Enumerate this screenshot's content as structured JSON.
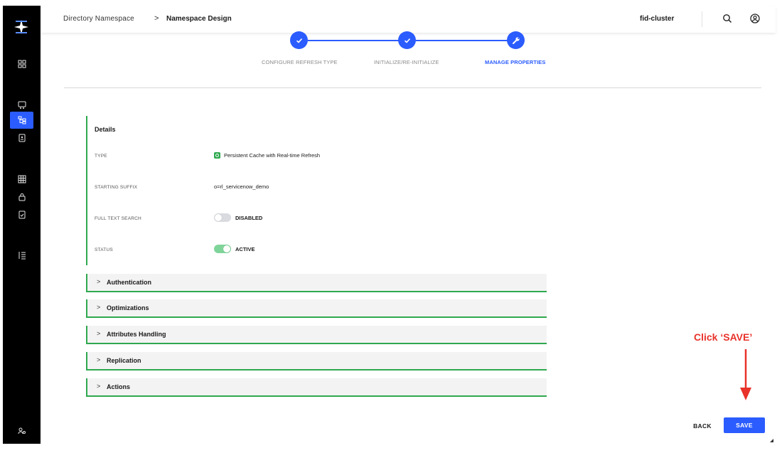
{
  "breadcrumb": {
    "parent": "Directory Namespace",
    "separator": ">",
    "current": "Namespace Design"
  },
  "header": {
    "cluster": "fid-cluster",
    "icons": [
      "search-icon",
      "user-icon"
    ]
  },
  "sidebar": {
    "icons": [
      "logo-icon",
      "dashboard-icon",
      "monitoring-icon",
      "namespace-icon",
      "directory-browser-icon",
      "schema-icon",
      "security-icon",
      "audit-icon",
      "logs-icon",
      "admin-icon"
    ],
    "active": "namespace-icon"
  },
  "stepper": {
    "steps": [
      {
        "label": "CONFIGURE REFRESH TYPE",
        "state": "complete",
        "icon": "check-icon"
      },
      {
        "label": "INITIALIZE/RE-INITIALIZE",
        "state": "complete",
        "icon": "check-icon"
      },
      {
        "label": "MANAGE PROPERTIES",
        "state": "active",
        "icon": "wrench-icon"
      }
    ]
  },
  "details": {
    "title": "Details",
    "type_label": "TYPE",
    "type_value": "Persistent Cache with Real-time Refresh",
    "suffix_label": "STARTING SUFFIX",
    "suffix_value": "o=rl_servicenow_demo",
    "fts_label": "FULL TEXT SEARCH",
    "fts_value": "DISABLED",
    "fts_enabled": false,
    "status_label": "STATUS",
    "status_value": "ACTIVE",
    "status_enabled": true
  },
  "sections": [
    {
      "label": "Authentication"
    },
    {
      "label": "Optimizations"
    },
    {
      "label": "Attributes Handling"
    },
    {
      "label": "Replication"
    },
    {
      "label": "Actions"
    }
  ],
  "annotation": {
    "text": "Click ‘SAVE’",
    "color": "#e8322a"
  },
  "footer": {
    "back_label": "BACK",
    "save_label": "SAVE"
  },
  "colors": {
    "accent": "#2b5cff",
    "section_border": "#2fa84f",
    "sidebar": "#000000"
  }
}
